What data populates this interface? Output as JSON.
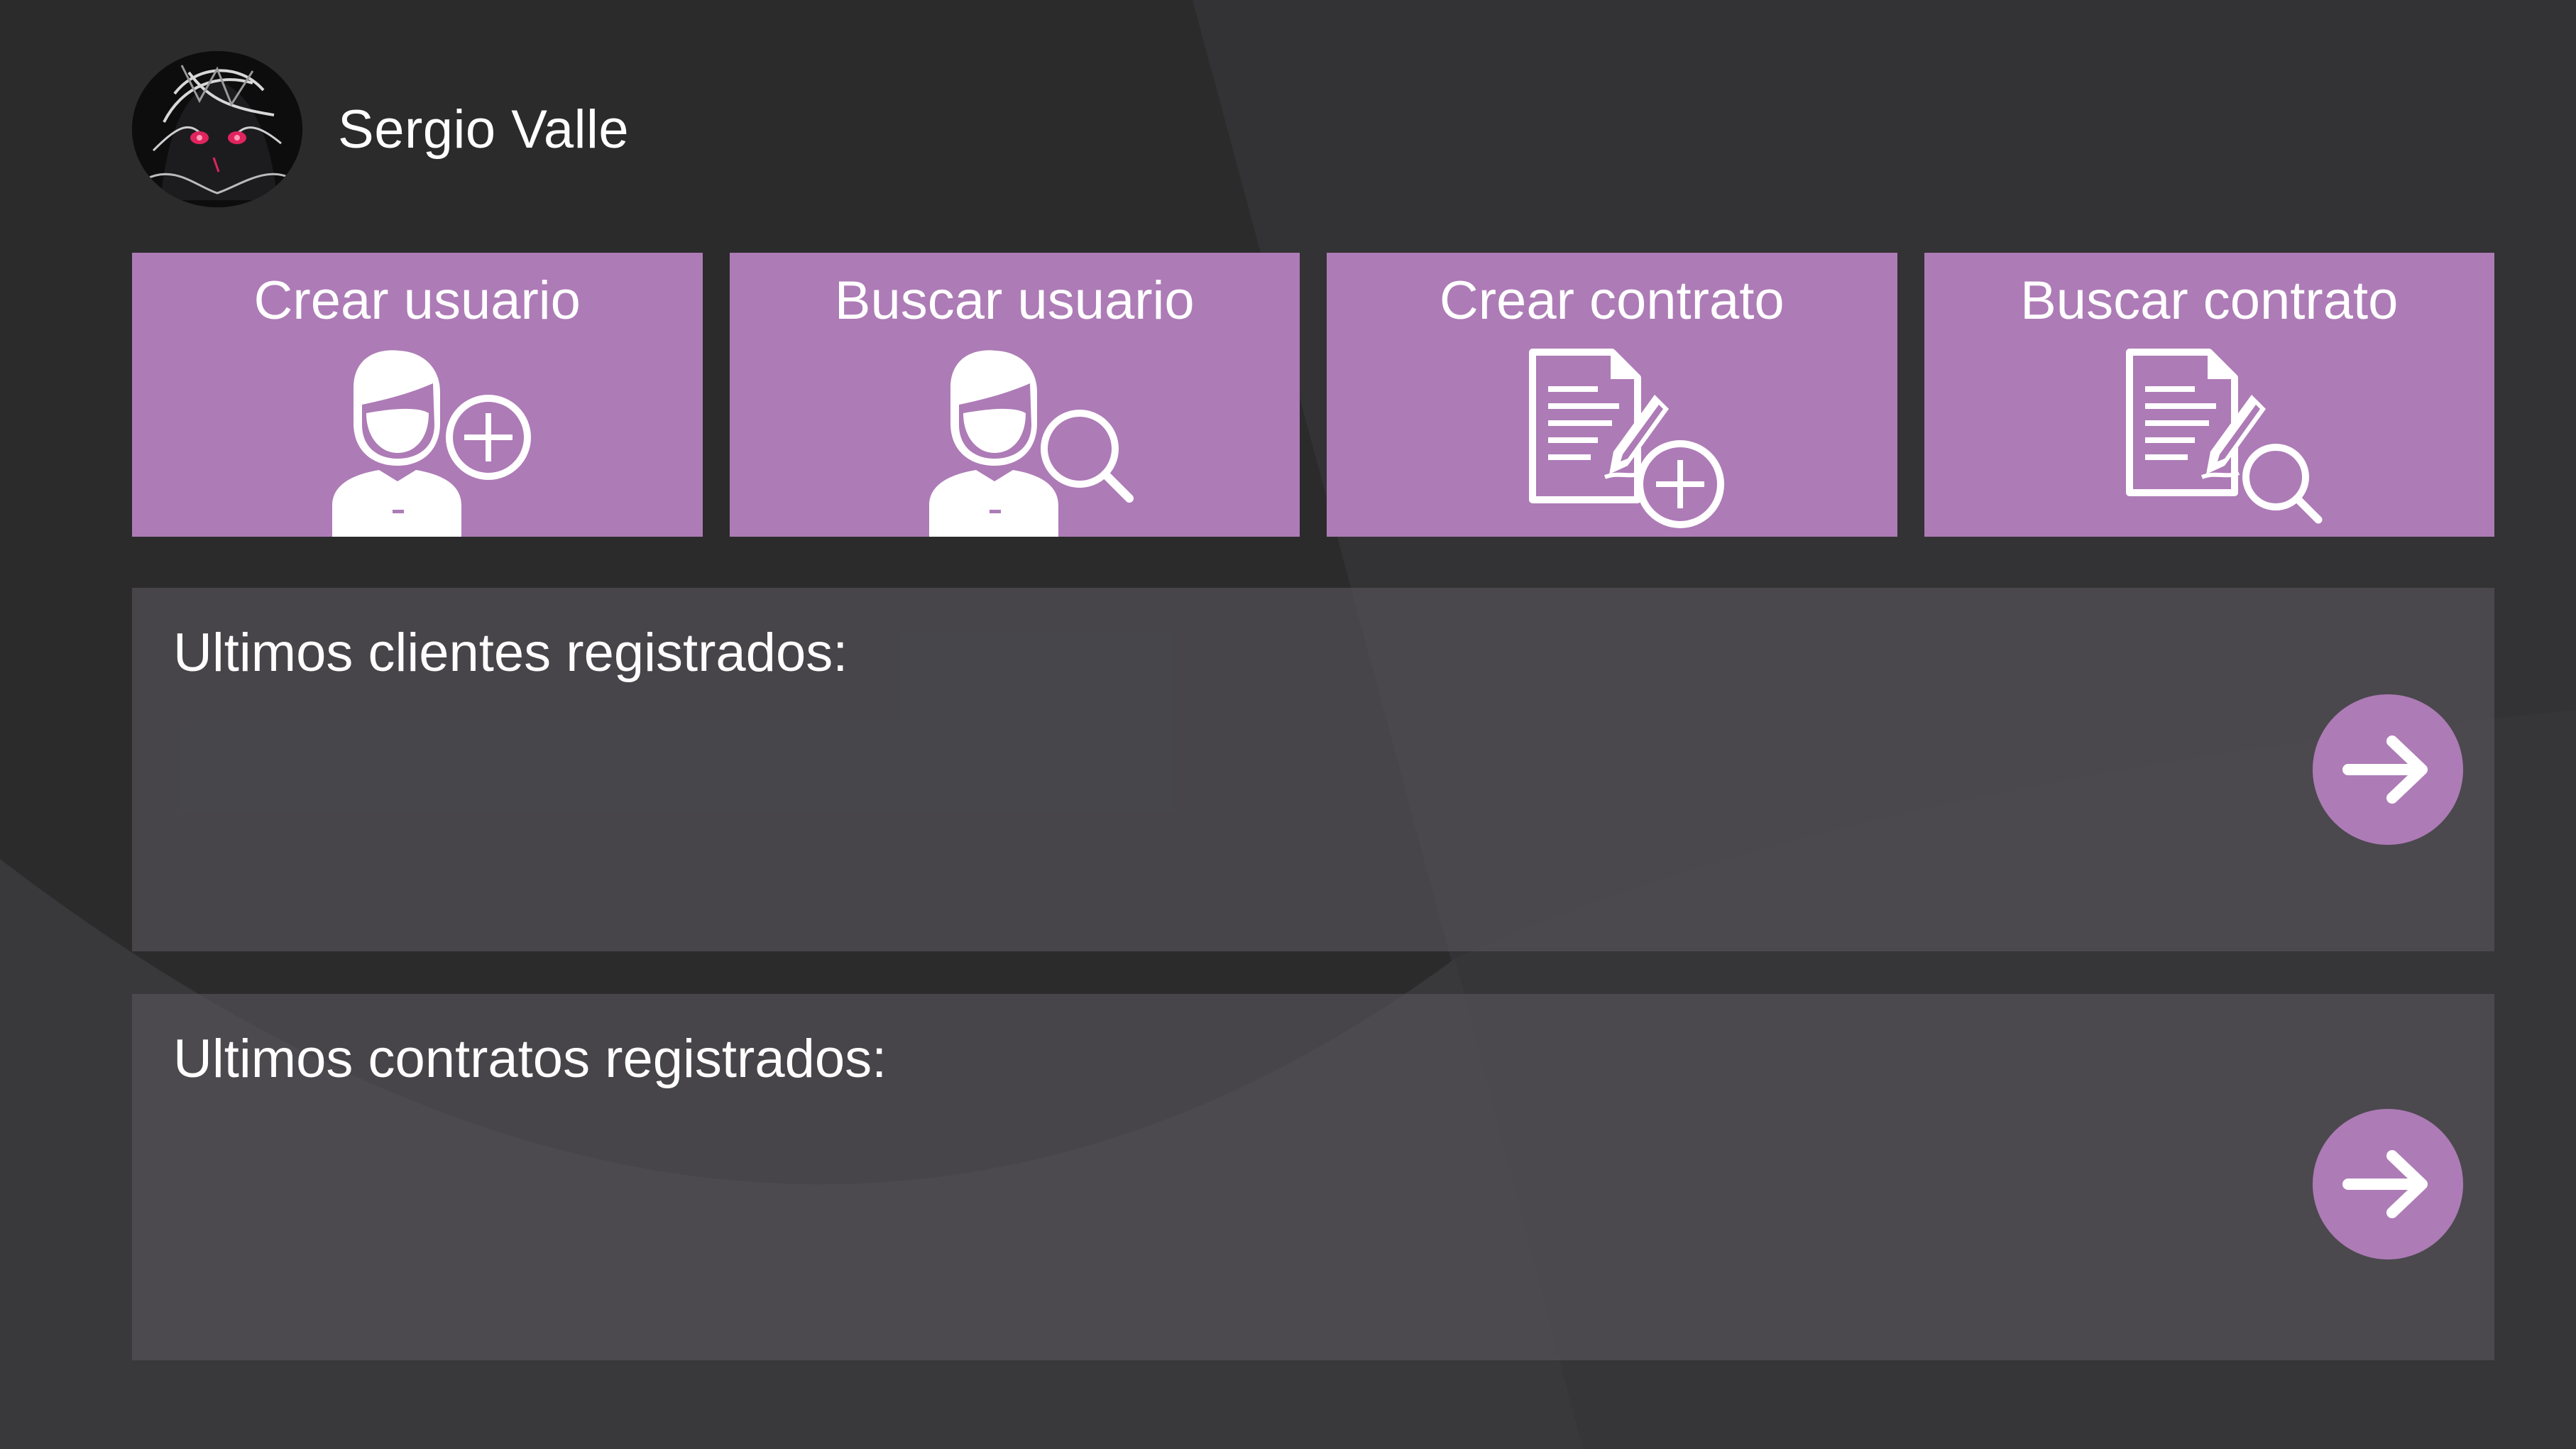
{
  "user": {
    "name": "Sergio Valle"
  },
  "tiles": [
    {
      "label": "Crear usuario",
      "icon": "user-add-icon"
    },
    {
      "label": "Buscar usuario",
      "icon": "user-search-icon"
    },
    {
      "label": "Crear contrato",
      "icon": "contract-add-icon"
    },
    {
      "label": "Buscar contrato",
      "icon": "contract-search-icon"
    }
  ],
  "panels": {
    "clients": {
      "title": "Ultimos clientes registrados:",
      "button_icon": "arrow-right-icon"
    },
    "contracts": {
      "title": "Ultimos contratos registrados:",
      "button_icon": "arrow-right-icon"
    }
  },
  "colors": {
    "background": "#2b2b2c",
    "accent": "#ad7bb6",
    "panel": "#4b4a4e",
    "text": "#ffffff"
  }
}
